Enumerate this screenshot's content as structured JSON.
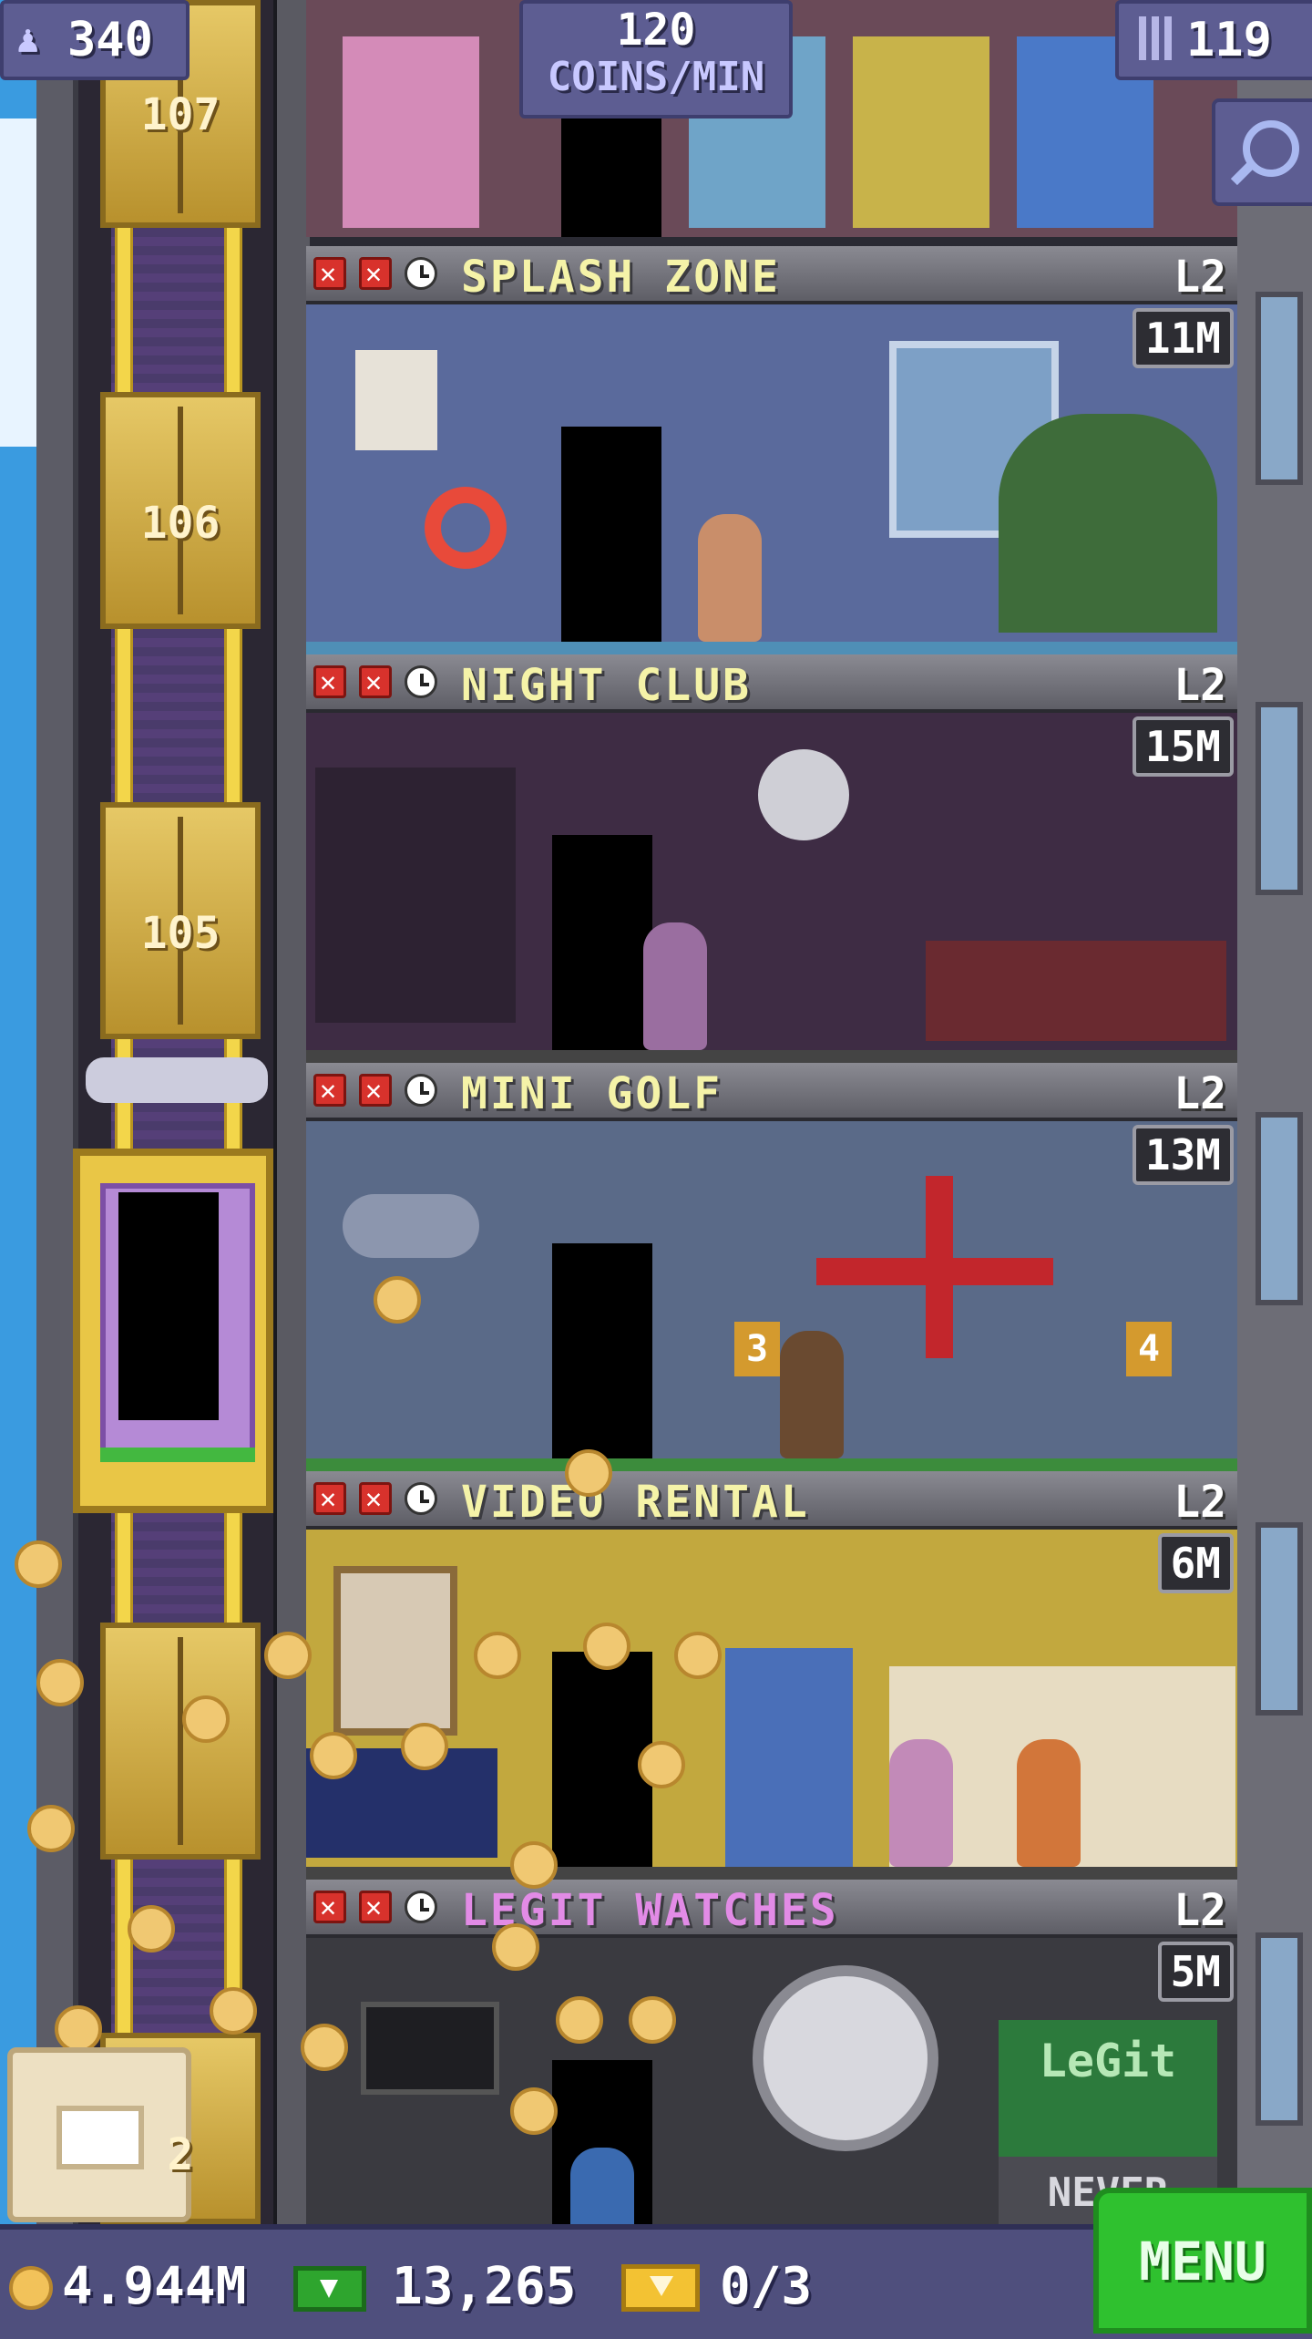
{
  "hud": {
    "population": "340",
    "coins_per_min_value": "120",
    "coins_per_min_unit": "COINS/MIN",
    "floor_count": "119"
  },
  "elevator": {
    "floor_numbers": [
      "107",
      "106",
      "105",
      "2"
    ]
  },
  "floors": [
    {
      "name": "SPLASH ZONE",
      "level": "L2",
      "earnings": "11M",
      "name_color": "#f5f3a8"
    },
    {
      "name": "NIGHT CLUB",
      "level": "L2",
      "earnings": "15M",
      "name_color": "#f5f3a8"
    },
    {
      "name": "MINI GOLF",
      "level": "L2",
      "earnings": "13M",
      "name_color": "#f5f3a8"
    },
    {
      "name": "VIDEO RENTAL",
      "level": "L2",
      "earnings": "6M",
      "name_color": "#f5f3a8"
    },
    {
      "name": "LEGIT WATCHES",
      "level": "L2",
      "earnings": "5M",
      "name_color": "#e28be6"
    }
  ],
  "scenery_text": {
    "golf_hole_3": "3",
    "golf_hole_4": "4",
    "watch_sign_brand": "LeGit",
    "watch_sign_slogan": "NEVER"
  },
  "bottom_bar": {
    "coins": "4.944M",
    "bux": "13,265",
    "tickets": "0/3",
    "menu_label": "MENU"
  },
  "icons": {
    "population": "person-icon",
    "floors": "building-icon",
    "search": "magnifier-icon",
    "coin": "coin-icon",
    "bux": "bux-icon",
    "ticket": "ticket-icon",
    "bitizens": "box-icon"
  },
  "colors": {
    "hud_bg": "#5d5d92",
    "menu_green": "#2fc12f",
    "elevator_gold": "#e9c646",
    "status_red": "#d8322c"
  }
}
